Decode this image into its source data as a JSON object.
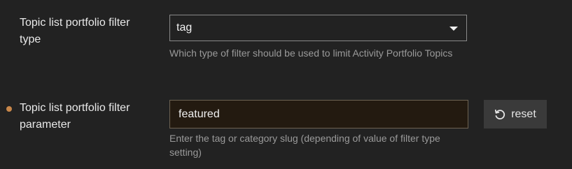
{
  "settings": [
    {
      "label": "Topic list portfolio filter type",
      "value": "tag",
      "description": "Which type of filter should be used to limit Activity Portfolio Topics"
    },
    {
      "label": "Topic list portfolio filter parameter",
      "value": "featured",
      "description": "Enter the tag or category slug (depending of value of filter type setting)",
      "overridden": true,
      "reset_label": "reset"
    }
  ],
  "icons": {
    "dropdown": "caret-down-icon",
    "reset": "undo-icon"
  },
  "colors": {
    "overridden_indicator": "#c8874a",
    "input_background": "#231a10",
    "page_background": "#222222"
  }
}
